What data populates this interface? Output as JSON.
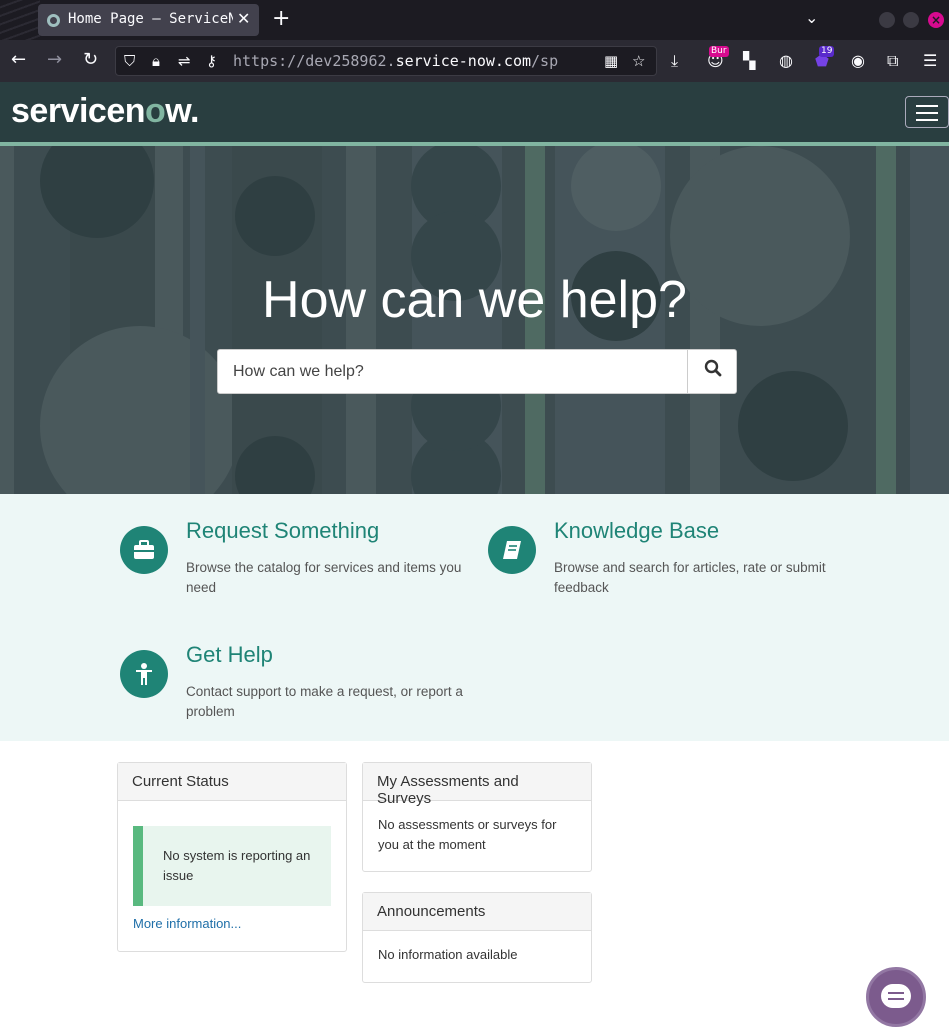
{
  "browser": {
    "tab_title": "Home Page – ServiceNow",
    "url_prefix": "https://dev258962.",
    "url_domain": "service-now.com",
    "url_path": "/sp",
    "ext_badge_1": "Bur",
    "ext_badge_2": "19"
  },
  "header": {
    "logo_text_1": "servicen",
    "logo_text_o": "o",
    "logo_text_2": "w."
  },
  "hero": {
    "title": "How can we help?",
    "search_placeholder": "How can we help?"
  },
  "tiles": [
    {
      "title": "Request Something",
      "desc": "Browse the catalog for services and items you need",
      "icon": "briefcase-icon"
    },
    {
      "title": "Knowledge Base",
      "desc": "Browse and search for articles, rate or submit feedback",
      "icon": "book-icon"
    },
    {
      "title": "Get Help",
      "desc": "Contact support to make a request, or report a problem",
      "icon": "person-help-icon"
    }
  ],
  "widgets": {
    "current_status": {
      "title": "Current Status",
      "message": "No system is reporting an issue",
      "link": "More information..."
    },
    "assessments": {
      "title": "My Assessments and Surveys",
      "message": "No assessments or surveys for you at the moment"
    },
    "announcements": {
      "title": "Announcements",
      "message": "No information available"
    }
  },
  "colors": {
    "header_bg": "#293e40",
    "accent": "#81b5a1",
    "tile_icon": "#1f8476",
    "tiles_bg": "#edf7f6",
    "status_ok": "#59b97f",
    "chat": "#7c5b8d"
  }
}
